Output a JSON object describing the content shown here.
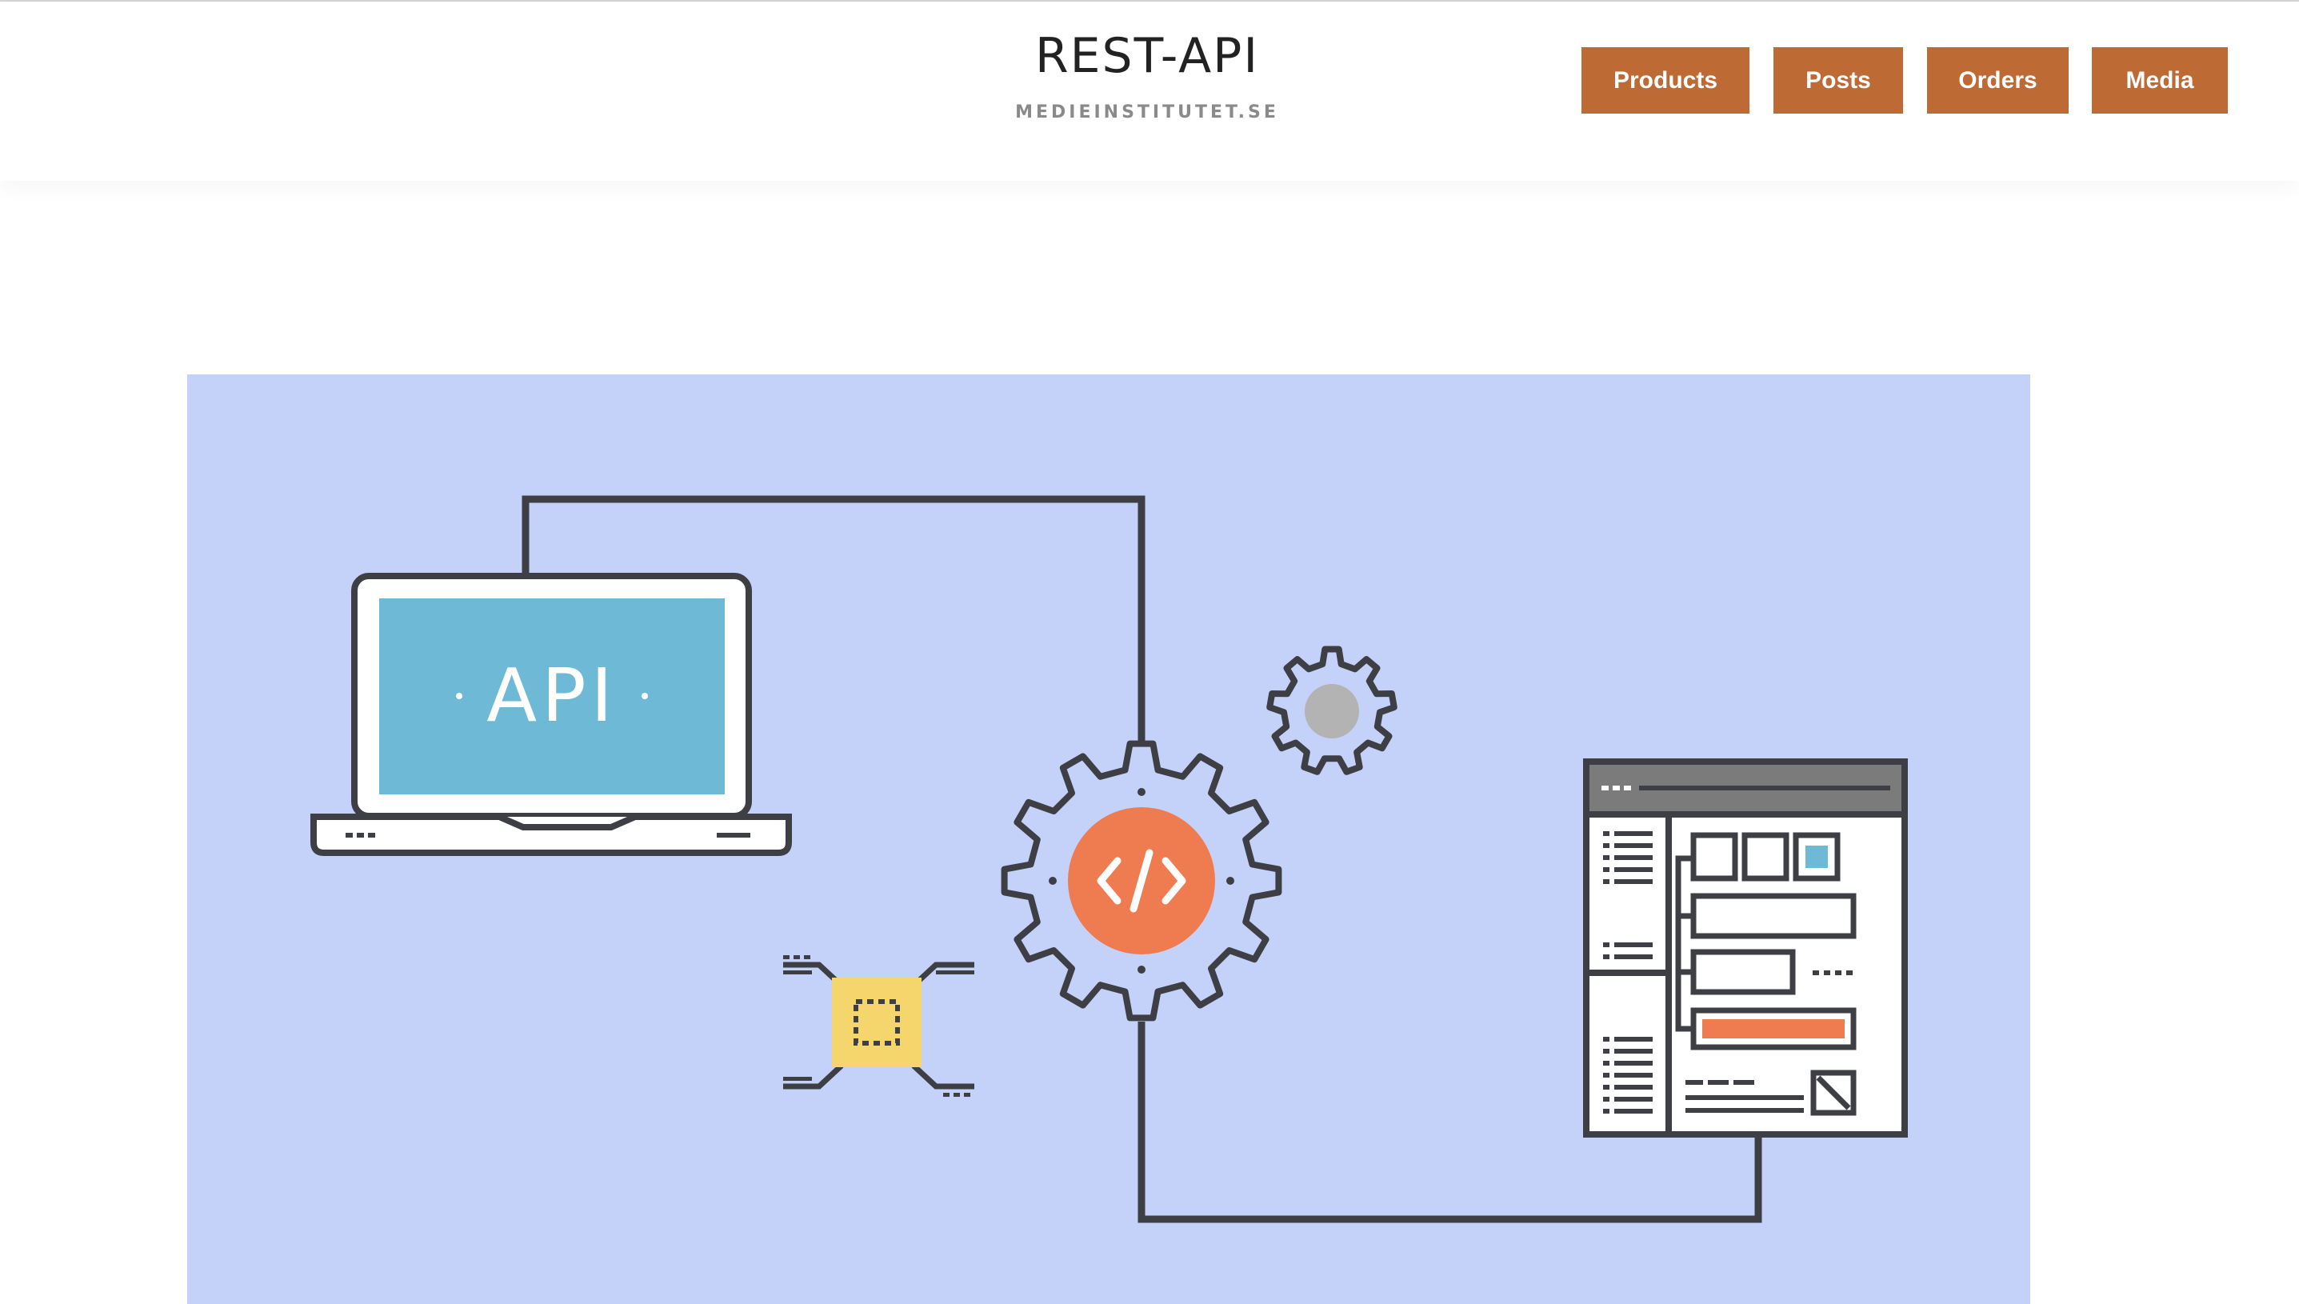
{
  "site": {
    "title": "REST-API",
    "tagline": "MEDIEINSTITUTET.SE"
  },
  "nav": {
    "items": [
      {
        "label": "Products"
      },
      {
        "label": "Posts"
      },
      {
        "label": "Orders"
      },
      {
        "label": "Media"
      }
    ],
    "button_color": "#bd6a35"
  },
  "hero": {
    "background_color": "#c4d1f9",
    "laptop_screen_text": "API",
    "code_symbol": "</>",
    "icons": [
      "laptop-icon",
      "gear-icon",
      "small-gear-icon",
      "chip-icon",
      "browser-window-icon"
    ]
  },
  "colors": {
    "outline": "#3d3f45",
    "screen": "#6ebad6",
    "code_circle": "#ef7b51",
    "chip": "#f5d66c",
    "small_gear_center": "#b3b3b3",
    "window_titlebar": "#7b7b7b",
    "highlight_bar": "#ef7b51",
    "highlight_square": "#6ebad6"
  }
}
